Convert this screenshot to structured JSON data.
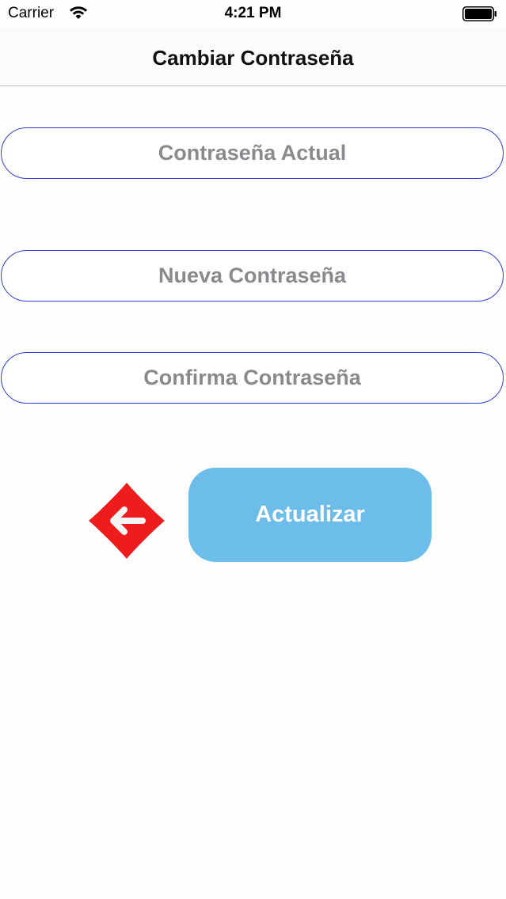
{
  "status_bar": {
    "carrier": "Carrier",
    "time": "4:21 PM",
    "wifi_icon": "wifi-icon",
    "battery_icon": "battery-icon"
  },
  "nav": {
    "title": "Cambiar Contraseña"
  },
  "form": {
    "current_password": {
      "placeholder": "Contraseña Actual",
      "value": ""
    },
    "new_password": {
      "placeholder": "Nueva Contraseña",
      "value": ""
    },
    "confirm_password": {
      "placeholder": "Confirma Contraseña",
      "value": ""
    }
  },
  "actions": {
    "back_icon": "back-arrow-icon",
    "update_label": "Actualizar"
  },
  "colors": {
    "field_border": "#2f3fd0",
    "placeholder": "#8a8a8e",
    "update_button_bg": "#6cbde9",
    "back_button_bg": "#ee1c1c",
    "back_arrow": "#f5f5f5"
  }
}
